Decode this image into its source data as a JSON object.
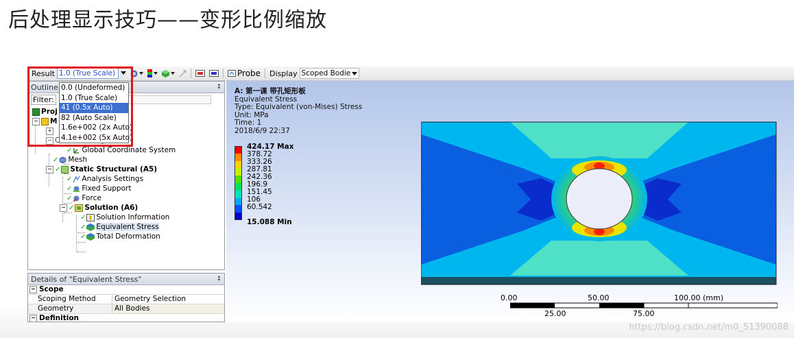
{
  "slide": {
    "title": "后处理显示技巧——变形比例缩放"
  },
  "toolbar": {
    "result_label": "Result",
    "scale_value": "1.0 (True Scale)",
    "probe_label": "Probe",
    "display_label": "Display",
    "display_value": "Scoped Bodie"
  },
  "scale_dropdown": {
    "options": [
      "0.0 (Undeformed)",
      "1.0 (True Scale)",
      "41 (0.5x Auto)",
      "82 (Auto Scale)",
      "1.6e+002 (2x Auto)",
      "4.1e+002 (5x Auto)"
    ],
    "selected_index": 2
  },
  "outline": {
    "title": "Outline",
    "filter_label": "Filter:",
    "project_label": "Proj",
    "model_label": "M",
    "coordinate_systems": "Coordinate Systems",
    "nodes": {
      "gcs": "Global Coordinate System",
      "mesh": "Mesh",
      "static": "Static Structural (A5)",
      "analysis": "Analysis Settings",
      "fixed": "Fixed Support",
      "force": "Force",
      "solution": "Solution (A6)",
      "solinfo": "Solution Information",
      "eqstress": "Equivalent Stress",
      "totdef": "Total Deformation"
    }
  },
  "details": {
    "title": "Details of \"Equivalent Stress\"",
    "sections": {
      "scope": "Scope",
      "definition": "Definition"
    },
    "rows": [
      {
        "key": "Scoping Method",
        "value": "Geometry Selection"
      },
      {
        "key": "Geometry",
        "value": "All Bodies"
      }
    ]
  },
  "viewport": {
    "header": {
      "title": "A: 第一课 带孔矩形板",
      "result_type": "Equivalent Stress",
      "type_line": "Type: Equivalent (von-Mises) Stress",
      "unit_line": "Unit: MPa",
      "time_line": "Time: 1",
      "date_line": "2018/6/9 22:37"
    },
    "legend": {
      "max_label": "424.17 Max",
      "min_label": "15.088 Min",
      "levels": [
        "378.72",
        "333.26",
        "287.81",
        "242.36",
        "196.9",
        "151.45",
        "106",
        "60.542"
      ],
      "colors": [
        "#ff0000",
        "#ff8c00",
        "#ffd300",
        "#c8f000",
        "#52e000",
        "#00e060",
        "#00e0c8",
        "#00a8ff",
        "#0050ff"
      ],
      "min_color": "#0000d0"
    },
    "scale_bar": {
      "top_labels": [
        "0.00",
        "50.00",
        "100.00 (mm)"
      ],
      "bottom_labels": [
        "25.00",
        "75.00"
      ]
    },
    "contour_colors": {
      "plate_light": "#4fe0c8",
      "plate_cyan": "#00b6ee",
      "plate_blue": "#0a5fe0",
      "deep_blue": "#0a2ccc",
      "green": "#3fd65a",
      "yellow": "#e8e400",
      "orange": "#ff8c00",
      "red": "#ff2000",
      "edge": "#1b5060"
    }
  },
  "watermark": "https://blog.csdn.net/m0_51390088"
}
